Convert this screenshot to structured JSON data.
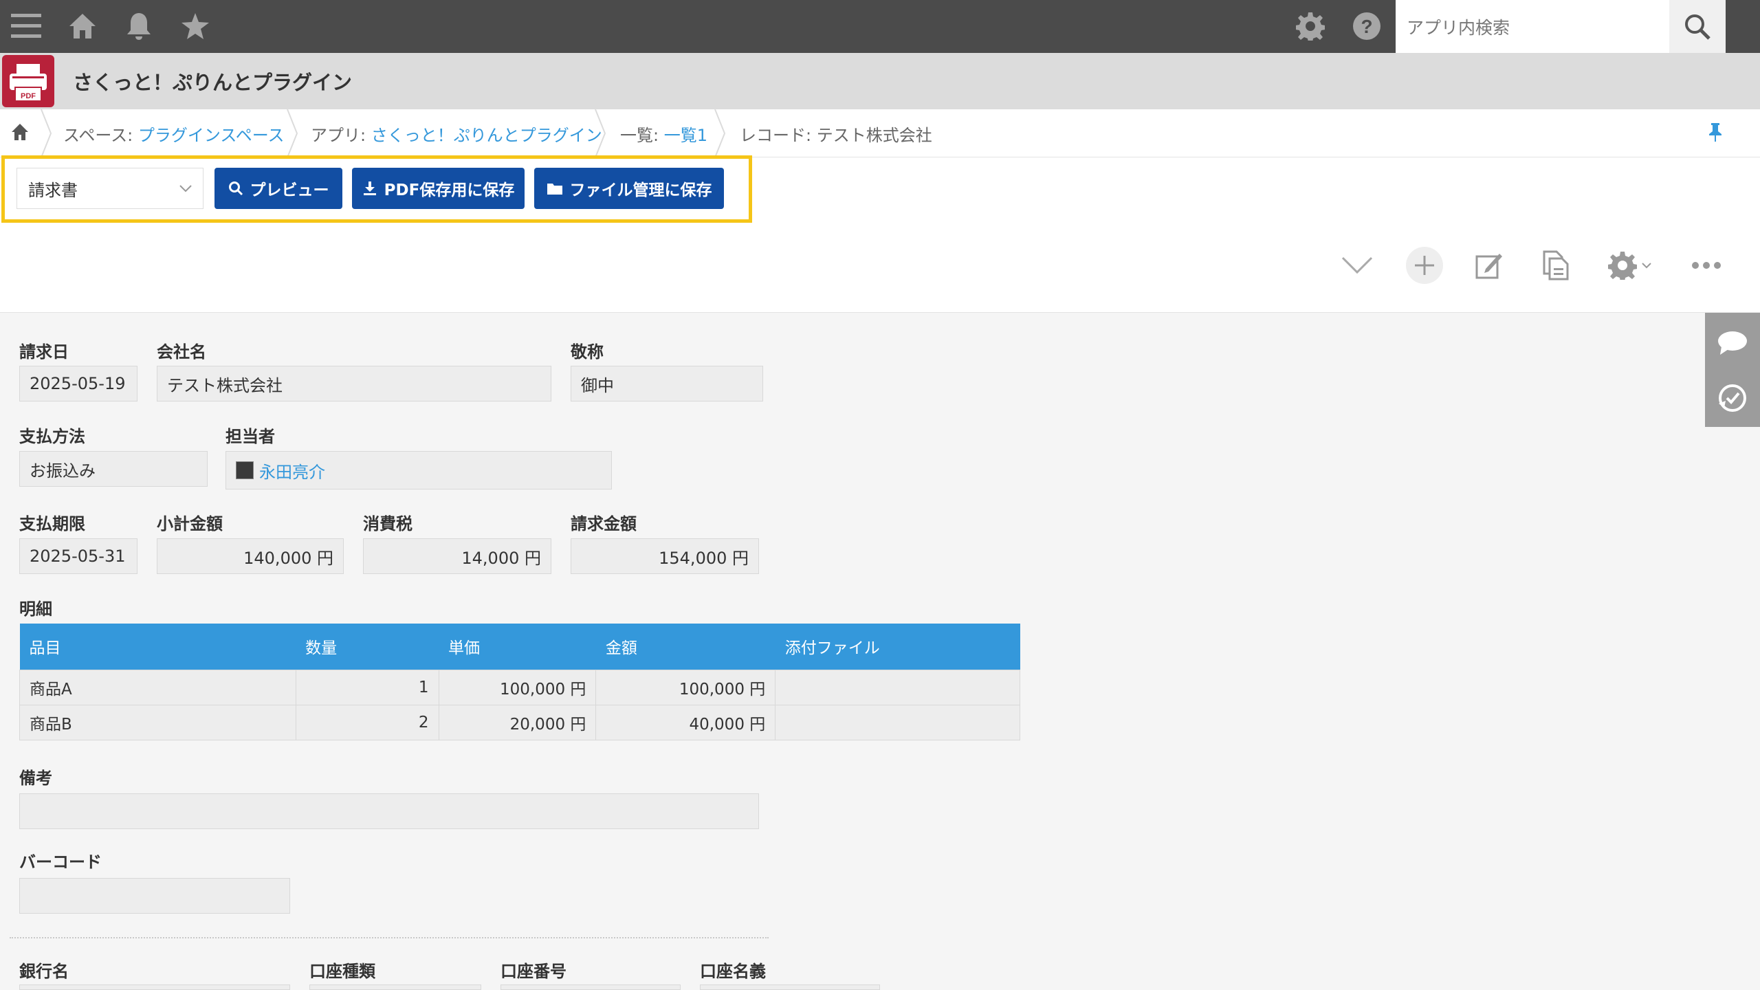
{
  "search": {
    "placeholder": "アプリ内検索"
  },
  "app": {
    "title": "さくっと！ぷりんとプラグイン",
    "icon_label": "PDF"
  },
  "breadcrumb": {
    "space_label": "スペース:",
    "space_name": "プラグインスペース",
    "app_label": "アプリ:",
    "app_name": "さくっと！ぷりんとプラグイン",
    "list_label": "一覧:",
    "list_name": "一覧1",
    "record_label": "レコード: テスト株式会社"
  },
  "plugin": {
    "template_selected": "請求書",
    "preview_label": "プレビュー",
    "pdf_save_label": "PDF保存用に保存",
    "file_save_label": "ファイル管理に保存"
  },
  "fields": {
    "invoice_date": {
      "label": "請求日",
      "value": "2025-05-19"
    },
    "company": {
      "label": "会社名",
      "value": "テスト株式会社"
    },
    "honorific": {
      "label": "敬称",
      "value": "御中"
    },
    "payment_method": {
      "label": "支払方法",
      "value": "お振込み"
    },
    "person": {
      "label": "担当者",
      "value": "永田亮介"
    },
    "due_date": {
      "label": "支払期限",
      "value": "2025-05-31"
    },
    "subtotal": {
      "label": "小計金額",
      "value": "140,000 円"
    },
    "tax": {
      "label": "消費税",
      "value": "14,000 円"
    },
    "total": {
      "label": "請求金額",
      "value": "154,000 円"
    },
    "remarks": {
      "label": "備考",
      "value": ""
    },
    "barcode": {
      "label": "バーコード",
      "value": ""
    },
    "bank": {
      "label": "銀行名"
    },
    "account_type": {
      "label": "口座種類"
    },
    "account_number": {
      "label": "口座番号"
    },
    "account_name": {
      "label": "口座名義"
    }
  },
  "details": {
    "label": "明細",
    "columns": [
      "品目",
      "数量",
      "単価",
      "金額",
      "添付ファイル"
    ],
    "rows": [
      [
        "商品A",
        "1",
        "100,000 円",
        "100,000 円",
        ""
      ],
      [
        "商品B",
        "2",
        "20,000 円",
        "40,000 円",
        ""
      ]
    ]
  },
  "colors": {
    "topbar": "#4b4b4b",
    "accent": "#3498db",
    "button": "#124ea3",
    "highlight": "#f5c518",
    "app_icon": "#b8213a"
  }
}
